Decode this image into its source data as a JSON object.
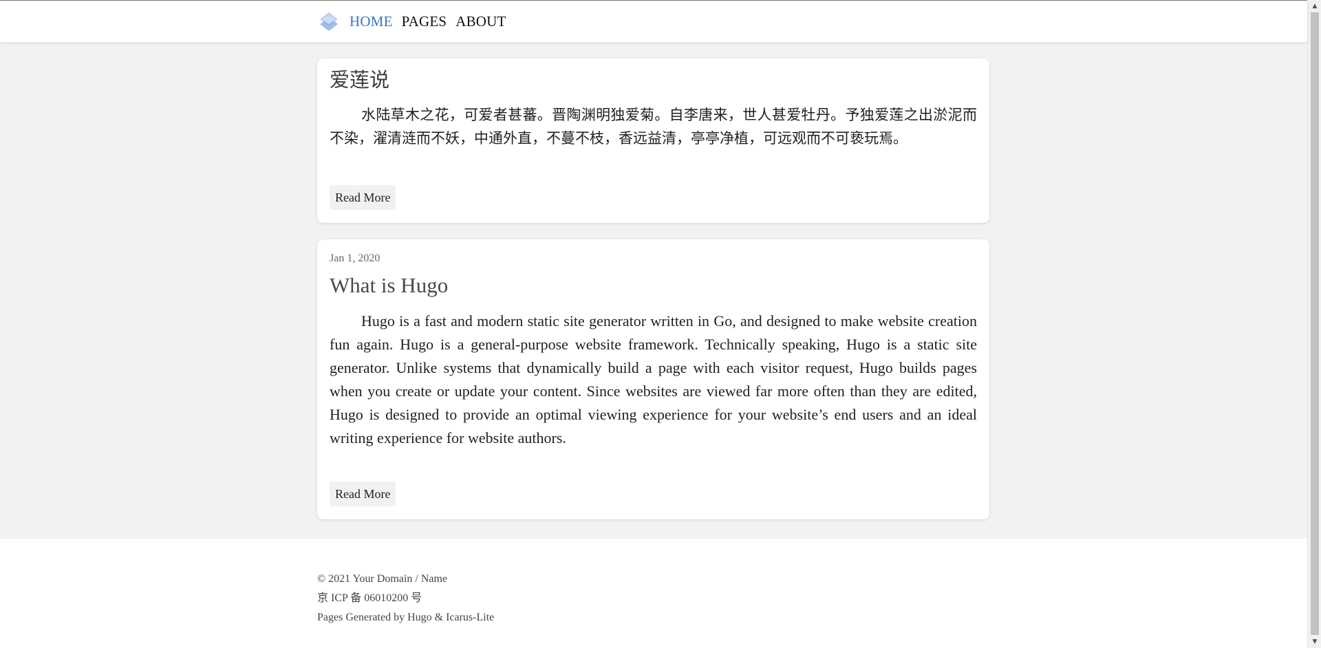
{
  "nav": {
    "logo_icon": "stacked-layers-logo-icon",
    "links": [
      {
        "label": "HOME",
        "active": true
      },
      {
        "label": "PAGES",
        "active": false
      },
      {
        "label": "ABOUT",
        "active": false
      }
    ],
    "active_color": "#3b73c8"
  },
  "posts": [
    {
      "title": "爱莲说",
      "excerpt": "水陆草木之花，可爱者甚蕃。晋陶渊明独爱菊。自李唐来，世人甚爱牡丹。予独爱莲之出淤泥而不染，濯清涟而不妖，中通外直，不蔓不枝，香远益清，亭亭净植，可远观而不可亵玩焉。",
      "read_more": "Read More"
    },
    {
      "date": "Jan 1, 2020",
      "title": "What is Hugo",
      "excerpt": "Hugo is a fast and modern static site generator written in Go, and designed to make website creation fun again. Hugo is a general-purpose website framework. Technically speaking, Hugo is a static site generator. Unlike systems that dynamically build a page with each visitor request, Hugo builds pages when you create or update your content. Since websites are viewed far more often than they are edited, Hugo is designed to provide an optimal viewing experience for your website’s end users and an ideal writing experience for website authors.",
      "read_more": "Read More"
    }
  ],
  "footer": {
    "copyright": "© 2021 Your Domain / Name",
    "icp": "京 ICP 备 06010200 号",
    "generator": "Pages Generated by Hugo & Icarus-Lite"
  },
  "colors": {
    "background": "#f2f2f2",
    "card": "#ffffff",
    "accent": "#3b73c8"
  }
}
